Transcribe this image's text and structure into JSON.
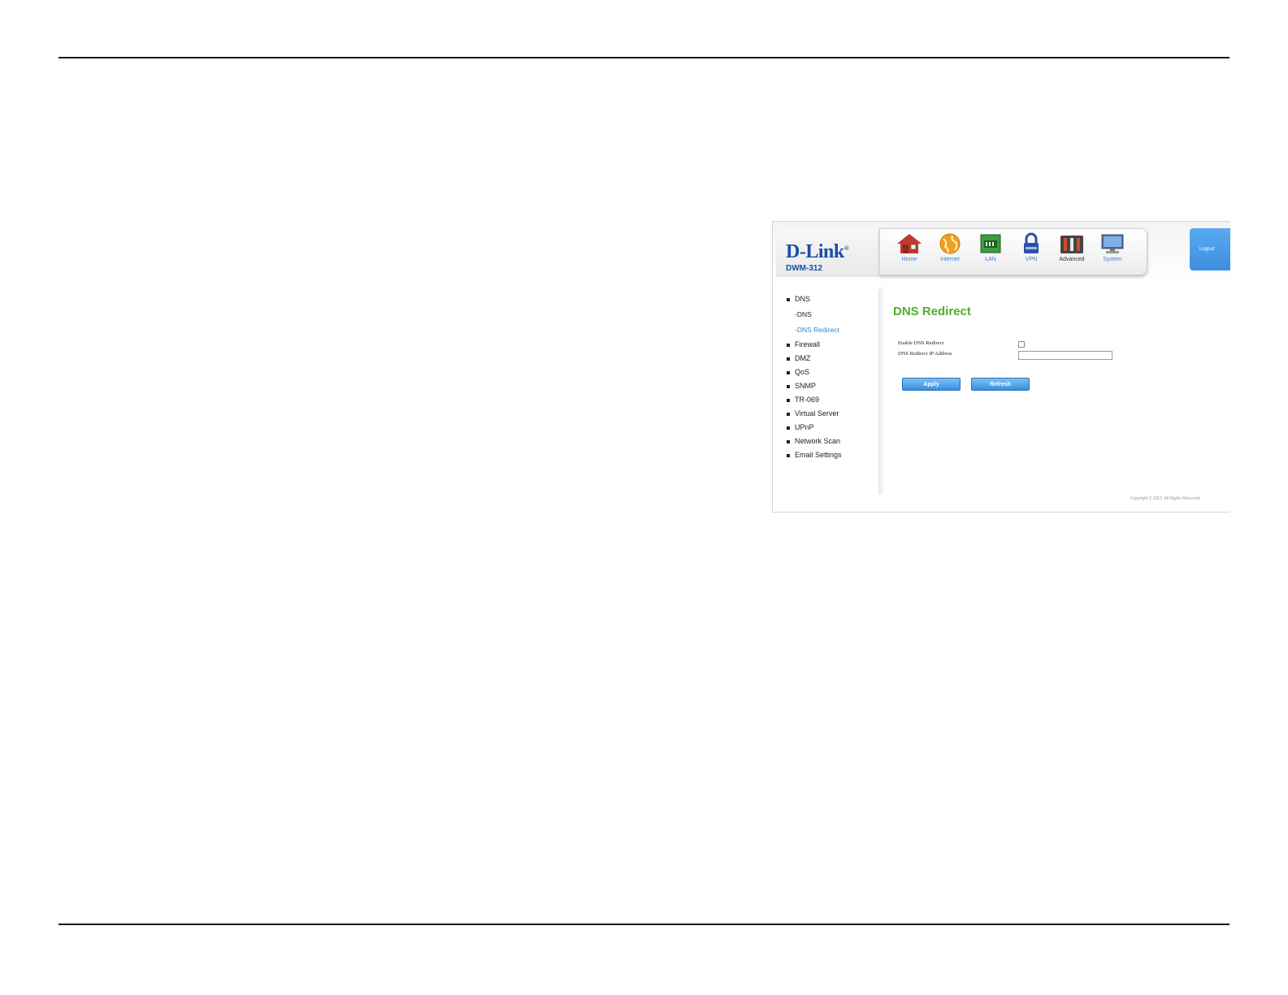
{
  "brand": {
    "logo": "D-Link",
    "model": "DWM-312"
  },
  "nav": [
    {
      "label": "Home",
      "icon": "home-icon"
    },
    {
      "label": "Internet",
      "icon": "globe-icon"
    },
    {
      "label": "LAN",
      "icon": "lan-icon"
    },
    {
      "label": "VPN",
      "icon": "lock-icon"
    },
    {
      "label": "Advanced",
      "icon": "tools-icon"
    },
    {
      "label": "System",
      "icon": "monitor-icon"
    }
  ],
  "logout_label": "Logout",
  "sidebar": {
    "dns": "DNS",
    "dns_sub": "-DNS",
    "dns_redirect_sub": "-DNS Redirect",
    "items": [
      "Firewall",
      "DMZ",
      "QoS",
      "SNMP",
      "TR-069",
      "Virtual Server",
      "UPnP",
      "Network Scan",
      "Email Settings"
    ]
  },
  "main": {
    "title": "DNS Redirect",
    "enable_label": "Enable DNS Redirect",
    "ip_label": "DNS Redirect IP Address",
    "ip_value": "",
    "enable_checked": false,
    "apply_label": "Apply",
    "refresh_label": "Refresh"
  },
  "copyright": "Copyright © 2012. All Rights Reserved",
  "colors": {
    "title_green": "#4caf2c",
    "link_blue": "#2f86d6",
    "button_blue": "#3a8fe0"
  }
}
